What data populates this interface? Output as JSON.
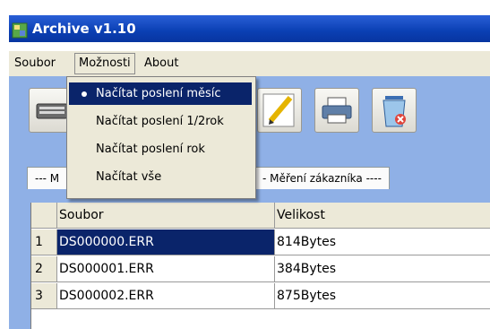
{
  "window": {
    "title": "Archive v1.10"
  },
  "menubar": {
    "items": [
      "Soubor",
      "Možnosti",
      "About"
    ]
  },
  "dropdown": {
    "items": [
      {
        "label": "Načítat poslení měsíc",
        "checked": true
      },
      {
        "label": "Načítat poslení 1/2rok",
        "checked": false
      },
      {
        "label": "Načítat poslení rok",
        "checked": false
      },
      {
        "label": "Načítat vše",
        "checked": false
      }
    ]
  },
  "toolbar": {
    "icons": [
      "keyboard-icon",
      "edit-pencil-icon",
      "printer-icon",
      "recycle-bin-icon"
    ]
  },
  "tabs": {
    "left_label": "--- M",
    "right_label": "- Měření zákazníka ----"
  },
  "table": {
    "columns": [
      "Soubor",
      "Velikost"
    ],
    "rows": [
      {
        "num": "1",
        "file": "DS000000.ERR",
        "size": "814Bytes",
        "selected": true
      },
      {
        "num": "2",
        "file": "DS000001.ERR",
        "size": "384Bytes",
        "selected": false
      },
      {
        "num": "3",
        "file": "DS000002.ERR",
        "size": "875Bytes",
        "selected": false
      }
    ]
  },
  "colors": {
    "titlebar": "#0a3fb3",
    "selection": "#0a246a",
    "menu_bg": "#ece9d8",
    "panel_bg": "#8fb0e6"
  }
}
